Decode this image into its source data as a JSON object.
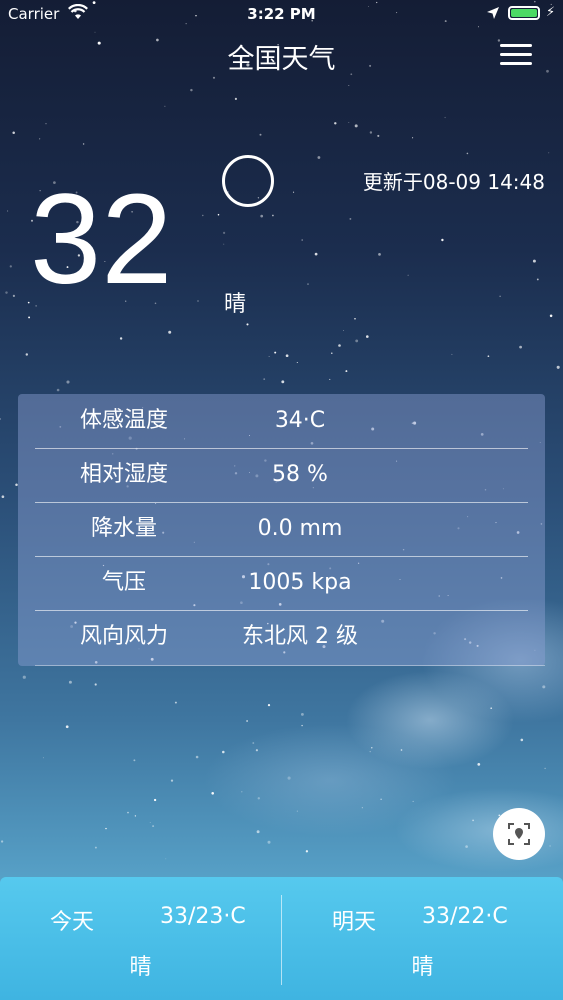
{
  "status_bar": {
    "carrier": "Carrier",
    "time": "3:22 PM"
  },
  "header": {
    "title": "全国天气"
  },
  "current": {
    "temperature": "32",
    "condition": "晴",
    "updated": "更新于08-09 14:48"
  },
  "details": [
    {
      "label": "体感温度",
      "value": "34·C"
    },
    {
      "label": "相对湿度",
      "value": "58 %"
    },
    {
      "label": "降水量",
      "value": "0.0 mm"
    },
    {
      "label": "气压",
      "value": "1005 kpa"
    },
    {
      "label": "风向风力",
      "value": "东北风 2 级"
    }
  ],
  "forecast": {
    "today": {
      "day": "今天",
      "range": "33/23·C",
      "condition": "晴"
    },
    "tomorrow": {
      "day": "明天",
      "range": "33/22·C",
      "condition": "晴"
    }
  },
  "colors": {
    "battery": "#4cd964",
    "forecast_bar": "#4fc1ea"
  },
  "icons": {
    "wifi": "wifi-icon",
    "location": "location-arrow-icon",
    "battery": "battery-icon",
    "menu": "hamburger-menu-icon",
    "weather": "sun-circle-icon",
    "locate": "locate-target-icon"
  }
}
